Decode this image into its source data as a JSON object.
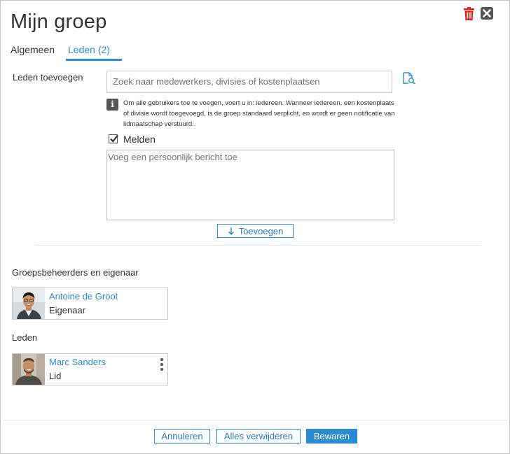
{
  "dialog": {
    "title": "Mijn groep"
  },
  "icons": {
    "delete": "trash-icon",
    "close": "close-icon",
    "browse": "search-document-icon",
    "info": "info-icon",
    "more": "more-vertical-icon",
    "add_arrow": "arrow-down-icon"
  },
  "tabs": [
    {
      "label": "Algemeen",
      "active": false
    },
    {
      "label": "Leden (2)",
      "active": true
    }
  ],
  "add_members": {
    "label": "Leden toevoegen",
    "search_placeholder": "Zoek naar medewerkers, divisies of kostenplaatsen",
    "info_text": "Om alle gebruikers toe te voegen, voert u in: iedereen. Wanneer iedereen, een kostenplaats of divisie wordt toegevoegd, is de groep standaard verplicht, en wordt er geen notificatie van lidmaatschap verstuurd.",
    "notify_label": "Melden",
    "notify_checked": true,
    "message_placeholder": "Voeg een persoonlijk bericht toe",
    "add_button": "Toevoegen"
  },
  "admins_section": {
    "label": "Groepsbeheerders en eigenaar",
    "members": [
      {
        "name": "Antoine de Groot",
        "role": "Eigenaar"
      }
    ]
  },
  "members_section": {
    "label": "Leden",
    "members": [
      {
        "name": "Marc Sanders",
        "role": "Lid"
      }
    ]
  },
  "footer": {
    "cancel": "Annuleren",
    "remove_all": "Alles verwijderen",
    "save": "Bewaren"
  },
  "colors": {
    "accent": "#2a8bd2",
    "delete": "#e0201b",
    "text": "#333333"
  }
}
